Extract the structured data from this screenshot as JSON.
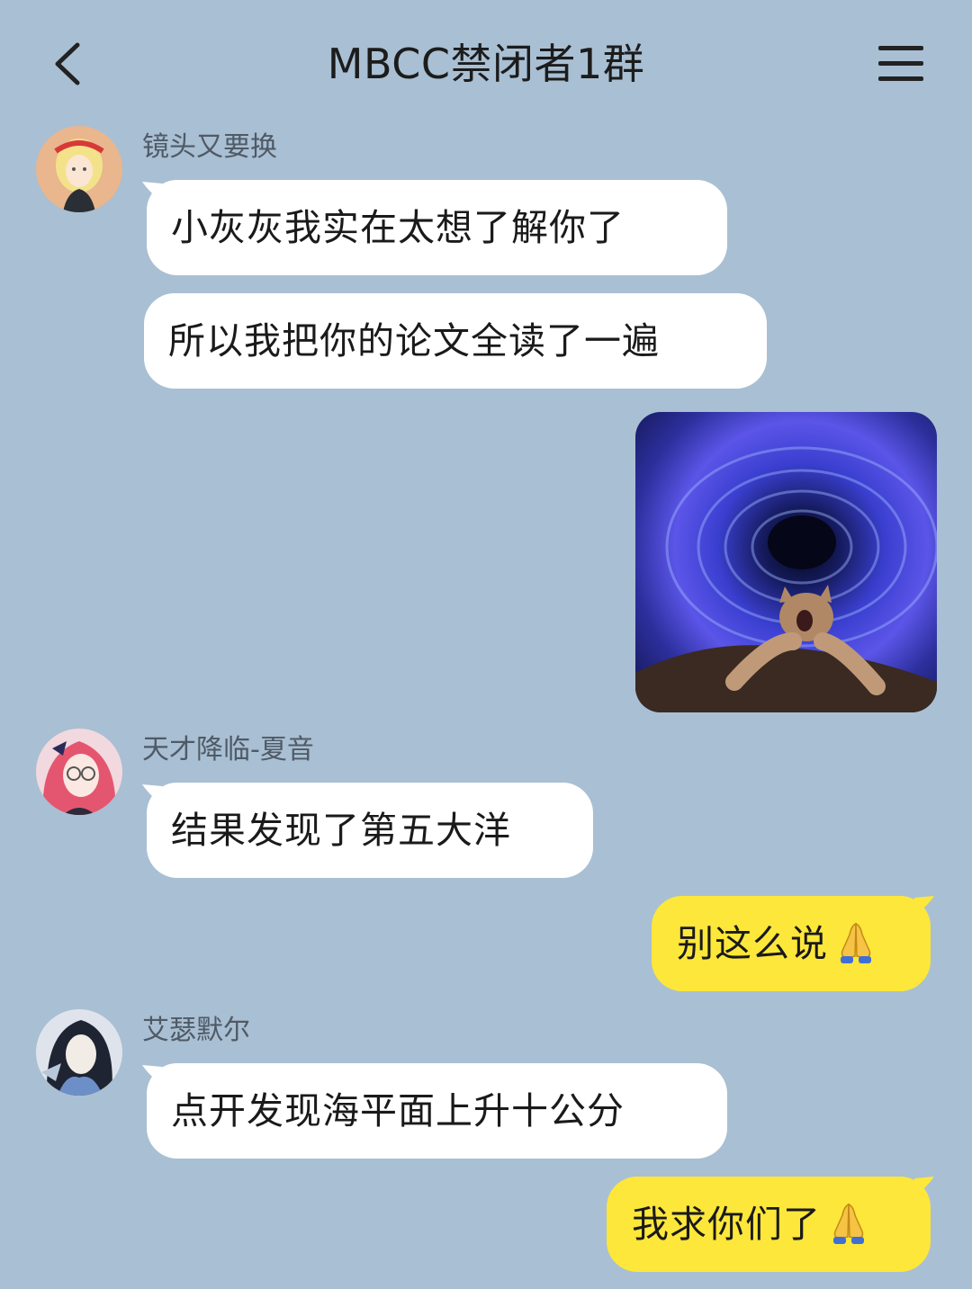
{
  "header": {
    "title": "MBCC禁闭者1群",
    "back_icon": "chevron-left-icon",
    "menu_icon": "hamburger-menu-icon"
  },
  "messages": [
    {
      "sender": "镜头又要换",
      "text": "小灰灰我实在太想了解你了"
    },
    {
      "text": "所以我把你的论文全读了一遍"
    },
    {
      "type": "image",
      "description_icon": "sticker-cat-wormhole"
    },
    {
      "sender": "天才降临-夏音",
      "text": "结果发现了第五大洋"
    },
    {
      "text": "别这么说",
      "emoji": "folded-hands-icon"
    },
    {
      "sender": "艾瑟默尔",
      "text": "点开发现海平面上升十公分"
    },
    {
      "text": "我求你们了",
      "emoji": "folded-hands-icon"
    }
  ],
  "colors": {
    "background": "#a9bfd3",
    "incoming_bubble": "#ffffff",
    "outgoing_bubble": "#fde73a"
  }
}
